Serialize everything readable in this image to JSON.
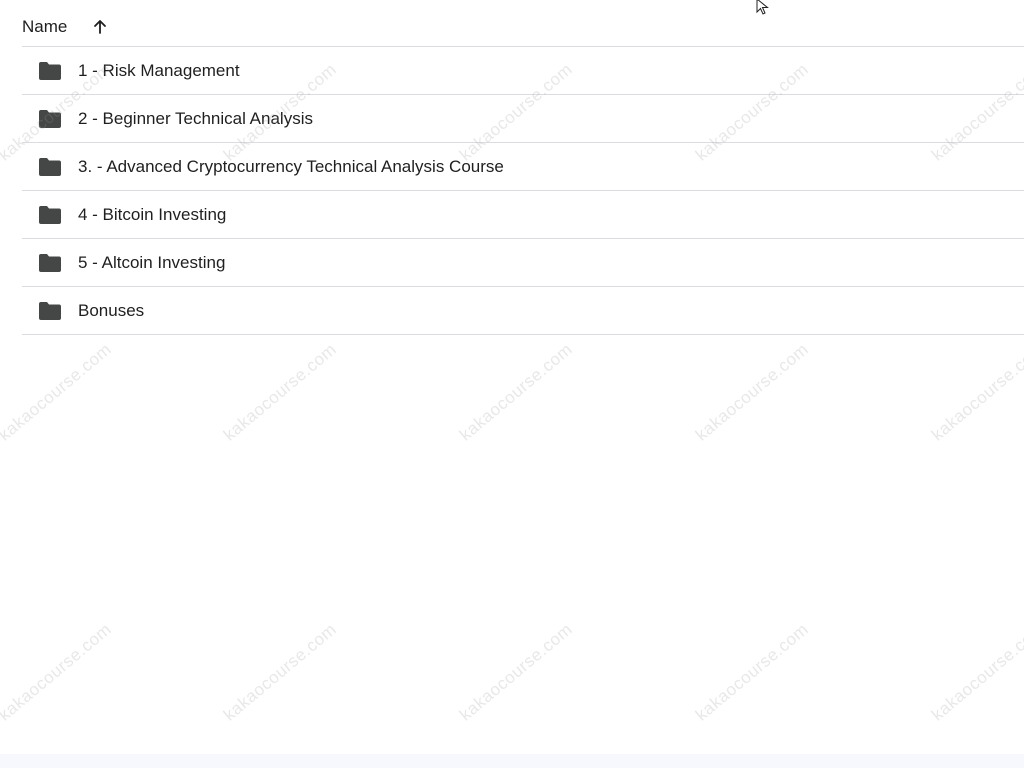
{
  "file_list": {
    "header": {
      "name_label": "Name",
      "sort_icon": "arrow-upward-icon"
    },
    "rows": [
      {
        "icon": "folder-icon",
        "label": "1 - Risk Management"
      },
      {
        "icon": "folder-icon",
        "label": "2 - Beginner Technical Analysis"
      },
      {
        "icon": "folder-icon",
        "label": "3. - Advanced Cryptocurrency Technical Analysis Course"
      },
      {
        "icon": "folder-icon",
        "label": "4 - Bitcoin Investing"
      },
      {
        "icon": "folder-icon",
        "label": "5 - Altcoin Investing"
      },
      {
        "icon": "folder-icon",
        "label": "Bonuses"
      }
    ]
  },
  "watermark": {
    "text": "kakaocourse.com",
    "color": "#969696"
  },
  "colors": {
    "divider": "#dadce0",
    "text": "#1f1f1f",
    "folder": "#444746"
  }
}
